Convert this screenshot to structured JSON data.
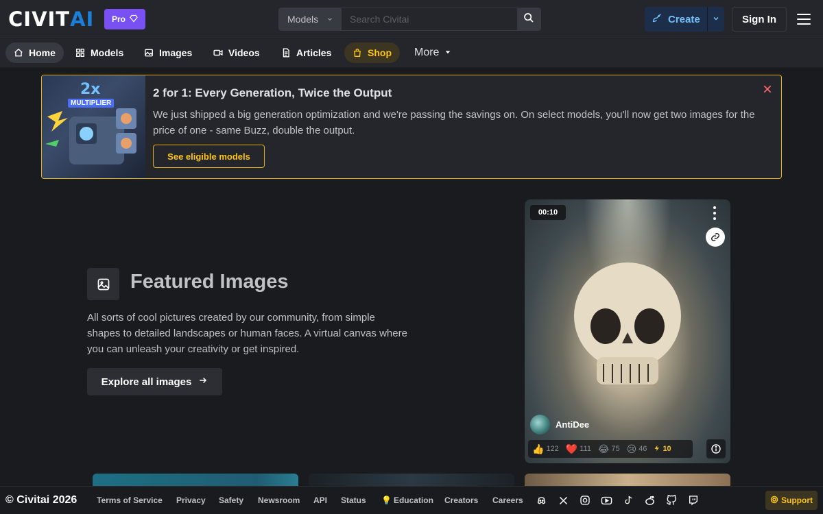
{
  "header": {
    "logo_main": "CIVIT",
    "logo_accent": "AI",
    "pro_label": "Pro",
    "search": {
      "scope": "Models",
      "placeholder": "Search Civitai",
      "shortcut": "/"
    },
    "create_label": "Create",
    "signin_label": "Sign In"
  },
  "nav": {
    "items": [
      {
        "label": "Home",
        "icon": "home-icon"
      },
      {
        "label": "Models",
        "icon": "grid-icon"
      },
      {
        "label": "Images",
        "icon": "image-icon"
      },
      {
        "label": "Videos",
        "icon": "video-icon"
      },
      {
        "label": "Articles",
        "icon": "article-icon"
      },
      {
        "label": "Shop",
        "icon": "bag-icon"
      },
      {
        "label": "More",
        "icon": "caret-down-icon"
      }
    ],
    "active": "Home"
  },
  "banner": {
    "title": "2 for 1: Every Generation, Twice the Output",
    "body": "We just shipped a big generation optimization and we're passing the savings on. On select models, you'll now get two images for the price of one - same Buzz, double the output.",
    "button_label": "See eligible models",
    "image_text": {
      "line1": "2x",
      "line2": "MULTIPLIER"
    },
    "border_color": "#e3b008"
  },
  "featured": {
    "title": "Featured Images",
    "description": "All sorts of cool pictures created by our community, from simple shapes to detailed landscapes or human faces. A virtual canvas where you can unleash your creativity or get inspired.",
    "button_label": "Explore all images"
  },
  "card": {
    "duration": "00:10",
    "username": "AntiDee",
    "reactions": [
      {
        "emoji": "👍",
        "count": "122"
      },
      {
        "emoji": "❤️",
        "count": "111"
      },
      {
        "emoji": "😂",
        "count": "75"
      },
      {
        "emoji": "😢",
        "count": "46"
      }
    ],
    "buzz": "10"
  },
  "footer": {
    "copyright": "© Civitai 2026",
    "links": [
      "Terms of Service",
      "Privacy",
      "Safety",
      "Newsroom",
      "API",
      "Status",
      "Education",
      "Creators",
      "Careers"
    ],
    "socials": [
      "discord-icon",
      "x-icon",
      "instagram-icon",
      "youtube-icon",
      "tiktok-icon",
      "reddit-icon",
      "github-icon",
      "twitch-icon"
    ],
    "support_label": "Support"
  },
  "colors": {
    "accent_blue": "#1c7ed6",
    "pro_purple": "#7950f2",
    "shop_yellow": "#fcc419",
    "background": "#1a1b1e"
  }
}
